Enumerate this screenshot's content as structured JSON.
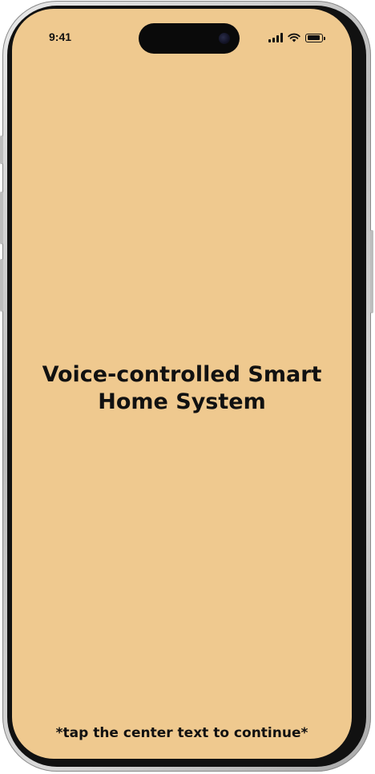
{
  "status_bar": {
    "time": "9:41",
    "icons": [
      "signal-icon",
      "wifi-icon",
      "battery-icon"
    ]
  },
  "main": {
    "title": "Voice-controlled Smart Home System",
    "hint": "*tap the center text to continue*"
  },
  "colors": {
    "background": "#efc98f",
    "text": "#111111",
    "frame": "#111111"
  }
}
